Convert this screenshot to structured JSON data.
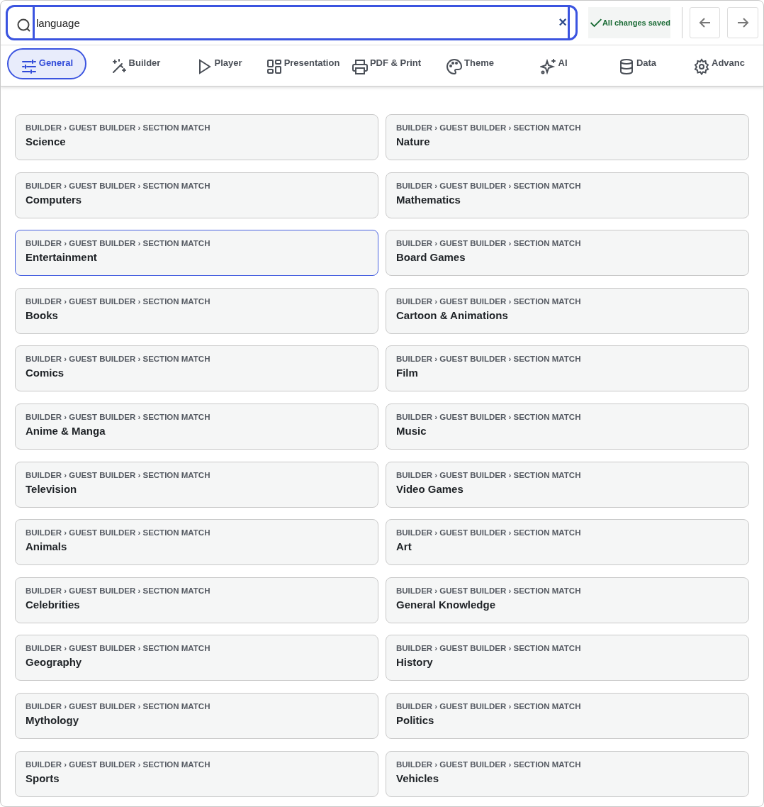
{
  "search": {
    "value": "language",
    "clear": "×"
  },
  "save_status": "All changes saved",
  "tabs": [
    {
      "label": "General",
      "kind": "sliders",
      "selected": true
    },
    {
      "label": "Builder",
      "kind": "wand",
      "selected": false
    },
    {
      "label": "Player",
      "kind": "play",
      "selected": false
    },
    {
      "label": "Presentation",
      "kind": "grid",
      "selected": false
    },
    {
      "label": "PDF & Print",
      "kind": "printer",
      "selected": false
    },
    {
      "label": "Theme",
      "kind": "palette",
      "selected": false
    },
    {
      "label": "AI",
      "kind": "sparkle",
      "selected": false
    },
    {
      "label": "Data",
      "kind": "database",
      "selected": false
    },
    {
      "label": "Advanc",
      "kind": "gear",
      "selected": false
    }
  ],
  "results": [
    {
      "path": "BUILDER › GUEST BUILDER › SECTION MATCH",
      "title": "Science",
      "selected": false
    },
    {
      "path": "BUILDER › GUEST BUILDER › SECTION MATCH",
      "title": "Nature",
      "selected": false
    },
    {
      "path": "BUILDER › GUEST BUILDER › SECTION MATCH",
      "title": "Computers",
      "selected": false
    },
    {
      "path": "BUILDER › GUEST BUILDER › SECTION MATCH",
      "title": "Mathematics",
      "selected": false
    },
    {
      "path": "BUILDER › GUEST BUILDER › SECTION MATCH",
      "title": "Entertainment",
      "selected": true
    },
    {
      "path": "BUILDER › GUEST BUILDER › SECTION MATCH",
      "title": "Board Games",
      "selected": false
    },
    {
      "path": "BUILDER › GUEST BUILDER › SECTION MATCH",
      "title": "Books",
      "selected": false
    },
    {
      "path": "BUILDER › GUEST BUILDER › SECTION MATCH",
      "title": "Cartoon & Animations",
      "selected": false
    },
    {
      "path": "BUILDER › GUEST BUILDER › SECTION MATCH",
      "title": "Comics",
      "selected": false
    },
    {
      "path": "BUILDER › GUEST BUILDER › SECTION MATCH",
      "title": "Film",
      "selected": false
    },
    {
      "path": "BUILDER › GUEST BUILDER › SECTION MATCH",
      "title": "Anime & Manga",
      "selected": false
    },
    {
      "path": "BUILDER › GUEST BUILDER › SECTION MATCH",
      "title": "Music",
      "selected": false
    },
    {
      "path": "BUILDER › GUEST BUILDER › SECTION MATCH",
      "title": "Television",
      "selected": false
    },
    {
      "path": "BUILDER › GUEST BUILDER › SECTION MATCH",
      "title": "Video Games",
      "selected": false
    },
    {
      "path": "BUILDER › GUEST BUILDER › SECTION MATCH",
      "title": "Animals",
      "selected": false
    },
    {
      "path": "BUILDER › GUEST BUILDER › SECTION MATCH",
      "title": "Art",
      "selected": false
    },
    {
      "path": "BUILDER › GUEST BUILDER › SECTION MATCH",
      "title": "Celebrities",
      "selected": false
    },
    {
      "path": "BUILDER › GUEST BUILDER › SECTION MATCH",
      "title": "General Knowledge",
      "selected": false
    },
    {
      "path": "BUILDER › GUEST BUILDER › SECTION MATCH",
      "title": "Geography",
      "selected": false
    },
    {
      "path": "BUILDER › GUEST BUILDER › SECTION MATCH",
      "title": "History",
      "selected": false
    },
    {
      "path": "BUILDER › GUEST BUILDER › SECTION MATCH",
      "title": "Mythology",
      "selected": false
    },
    {
      "path": "BUILDER › GUEST BUILDER › SECTION MATCH",
      "title": "Politics",
      "selected": false
    },
    {
      "path": "BUILDER › GUEST BUILDER › SECTION MATCH",
      "title": "Sports",
      "selected": false
    },
    {
      "path": "BUILDER › GUEST BUILDER › SECTION MATCH",
      "title": "Vehicles",
      "selected": false
    }
  ]
}
